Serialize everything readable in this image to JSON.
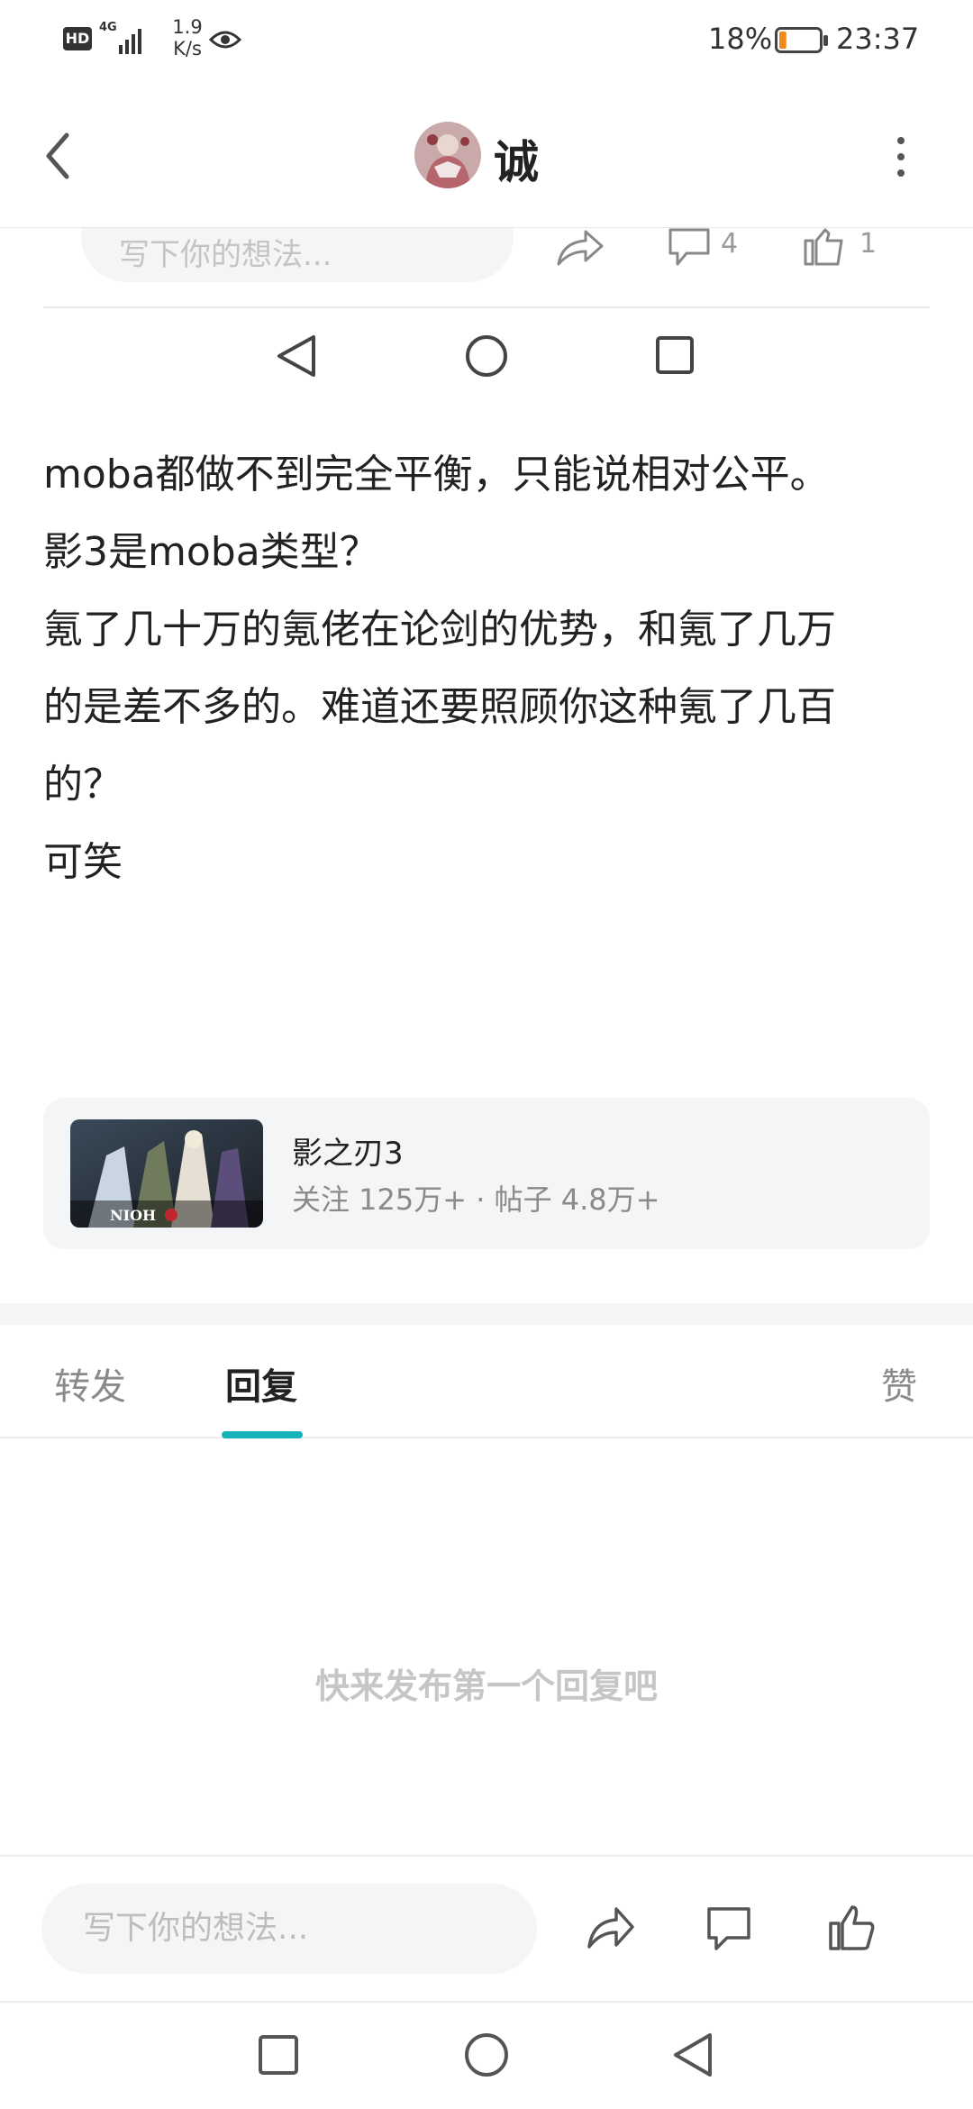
{
  "status_bar": {
    "hd": "HD",
    "network": "4G",
    "speed_value": "1.9",
    "speed_unit": "K/s",
    "battery": "18%",
    "battery_level_percent": 18,
    "time": "23:37"
  },
  "header": {
    "title": "诚"
  },
  "previous_post_bar": {
    "input_placeholder": "写下你的想法...",
    "comment_count": "4",
    "like_count": "1"
  },
  "post": {
    "lines": [
      "moba都做不到完全平衡，只能说相对公平。",
      "影3是moba类型？",
      "氪了几十万的氪佬在论剑的优势，和氪了几万",
      "的是差不多的。难道还要照顾你这种氪了几百",
      "的？",
      "可笑"
    ]
  },
  "game_card": {
    "name": "影之刃3",
    "stats": "关注 125万+ · 帖子 4.8万+",
    "thumbnail_text": "NIOH"
  },
  "tabs": [
    {
      "label": "转发"
    },
    {
      "label": "回复"
    },
    {
      "label": "赞"
    }
  ],
  "empty_state": "快来发布第一个回复吧",
  "bottom_bar": {
    "input_placeholder": "写下你的想法..."
  },
  "colors": {
    "accent": "#17b3b8",
    "battery_low": "#f08a1c"
  }
}
